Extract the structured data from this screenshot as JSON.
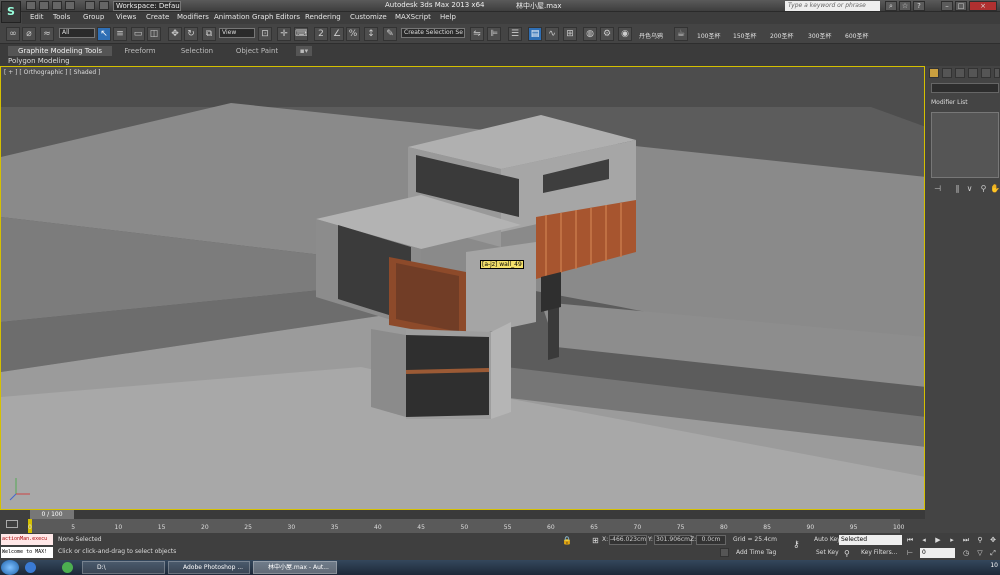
{
  "window": {
    "app_title": "Autodesk 3ds Max  2013 x64",
    "file_title": "林中小屋.max",
    "workspace": "Workspace: Default",
    "help_search_placeholder": "Type a keyword or phrase"
  },
  "menu": [
    "Edit",
    "Tools",
    "Group",
    "Views",
    "Create",
    "Modifiers",
    "Animation",
    "Graph Editors",
    "Rendering",
    "Customize",
    "MAXScript",
    "Help"
  ],
  "toolbar": {
    "selection_filter": "All",
    "ref_coord": "View",
    "named_selection": "Create Selection Se",
    "script_buttons": [
      "丹色乌鸦",
      "100圣杯",
      "150圣杯",
      "200圣杯",
      "300圣杯",
      "600圣杯"
    ]
  },
  "ribbon": {
    "tabs": [
      "Graphite Modeling Tools",
      "Freeform",
      "Selection",
      "Object Paint"
    ],
    "panel": "Polygon Modeling"
  },
  "viewport": {
    "label": "[ + ] [ Orthographic ] [ Shaded ]",
    "tooltip": "[a-jz] wall_49"
  },
  "command_panel": {
    "modifier_list": "Modifier List"
  },
  "timeline": {
    "slider": "0 / 100",
    "ticks": [
      "0",
      "5",
      "10",
      "15",
      "20",
      "25",
      "30",
      "35",
      "40",
      "45",
      "50",
      "55",
      "60",
      "65",
      "70",
      "75",
      "80",
      "85",
      "90",
      "95",
      "100"
    ]
  },
  "status": {
    "maxscript_line1": "actionMan.execu",
    "maxscript_line2": "Welcome to MAX!",
    "selection": "None Selected",
    "prompt": "Click or click-and-drag to select objects",
    "x_label": "X:",
    "x_value": "-466.023cm",
    "y_label": "Y:",
    "y_value": "301.906cm",
    "z_label": "Z:",
    "z_value": "0.0cm",
    "grid": "Grid = 25.4cm",
    "add_time_tag": "Add Time Tag",
    "auto_key": "Auto Key",
    "set_key": "Set Key",
    "key_mode": "Selected",
    "key_filters": "Key Filters...",
    "frame": "0"
  },
  "taskbar": {
    "items": [
      "D:\\",
      "Adobe Photoshop ...",
      "林中小屋.max - Aut..."
    ],
    "clock": "10"
  }
}
